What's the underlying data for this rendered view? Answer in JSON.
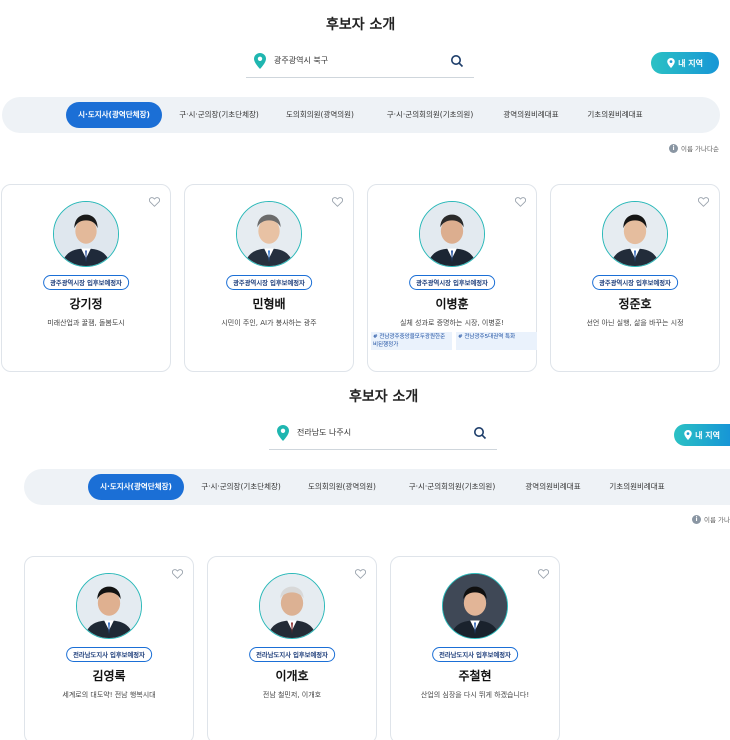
{
  "sections": [
    {
      "title": "후보자 소개",
      "search": {
        "value": "광주광역시 북구"
      },
      "my_region": "내 지역",
      "tabs": [
        {
          "label": "시·도지사(광역단체장)",
          "active": true
        },
        {
          "label": "구·시·군의장(기초단체장)",
          "active": false
        },
        {
          "label": "도의회의원(광역의원)",
          "active": false
        },
        {
          "label": "구·시·군의회의원(기초의원)",
          "active": false
        },
        {
          "label": "광역의원비례대표",
          "active": false
        },
        {
          "label": "기초의원비례대표",
          "active": false
        }
      ],
      "sort_note": "이름 가나다순",
      "candidates": [
        {
          "badge": "광주광역시장 입후보예정자",
          "name": "강기정",
          "slogan": "미래산업과 꿀잼, 돌봄도시",
          "tags": []
        },
        {
          "badge": "광주광역시장 입후보예정자",
          "name": "민형배",
          "slogan": "시민이 주인, AI가 봉사하는 광주",
          "tags": []
        },
        {
          "badge": "광주광역시장 입후보예정자",
          "name": "이병훈",
          "slogan": "실체 성과로 증명하는 시장, 이병훈!",
          "tags": [
            "# 전남광주중앙을모두광원한준비된행정가",
            "# 전남광주5대권역 특화"
          ]
        },
        {
          "badge": "광주광역시장 입후보예정자",
          "name": "정준호",
          "slogan": "선언 아닌 실행, 삶을 바꾸는 시정",
          "tags": []
        }
      ]
    },
    {
      "title": "후보자 소개",
      "search": {
        "value": "전라남도 나주시"
      },
      "my_region": "내 지역",
      "tabs": [
        {
          "label": "시·도지사(광역단체장)",
          "active": true
        },
        {
          "label": "구·시·군의장(기초단체장)",
          "active": false
        },
        {
          "label": "도의회의원(광역의원)",
          "active": false
        },
        {
          "label": "구·시·군의회의원(기초의원)",
          "active": false
        },
        {
          "label": "광역의원비례대표",
          "active": false
        },
        {
          "label": "기초의원비례대표",
          "active": false
        }
      ],
      "sort_note": "이름 가나",
      "candidates": [
        {
          "badge": "전라남도지사 입후보예정자",
          "name": "김영록",
          "slogan": "세계로의 대도약! 전남 행복시대",
          "tags": []
        },
        {
          "badge": "전라남도지사 입후보예정자",
          "name": "이개호",
          "slogan": "전남 철민저, 이개호",
          "tags": []
        },
        {
          "badge": "전라남도지사 입후보예정자",
          "name": "주철현",
          "slogan": "산업의 심장을 다시 뛰게 하겠습니다!",
          "tags": []
        }
      ]
    }
  ],
  "colors": {
    "accent": "#1b6fd6",
    "teal": "#2bb9b9",
    "tab_bg": "#eef2f6"
  },
  "icons": {
    "pin": "location-pin-icon",
    "search": "search-icon",
    "heart": "heart-outline-icon",
    "info": "info-icon"
  }
}
